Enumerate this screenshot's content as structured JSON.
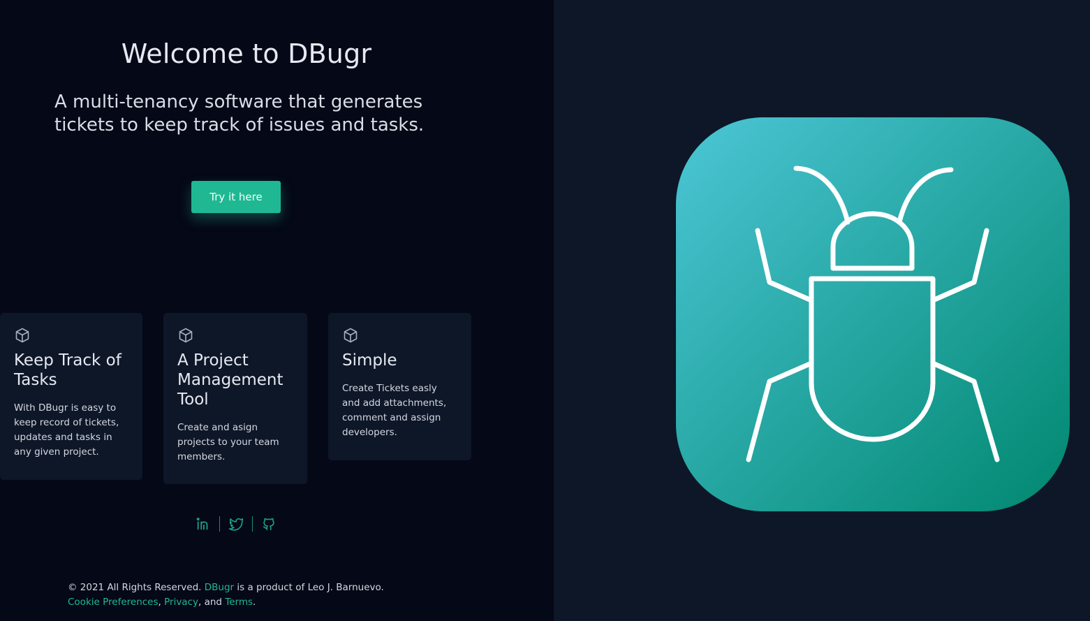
{
  "hero": {
    "title": "Welcome to DBugr",
    "subtitle": "A multi-tenancy software that generates tickets to keep track of issues and tasks.",
    "cta_label": "Try it here"
  },
  "features": [
    {
      "icon": "cube-icon",
      "title": "Keep Track of Tasks",
      "description": "With DBugr is easy to keep record of tickets, updates and tasks in any given project."
    },
    {
      "icon": "cube-icon",
      "title": "A Project Management Tool",
      "description": "Create and asign projects to your team members."
    },
    {
      "icon": "cube-icon",
      "title": "Simple",
      "description": "Create Tickets easly and add attachments, comment and assign developers."
    }
  ],
  "socials": [
    {
      "icon": "linkedin-icon"
    },
    {
      "icon": "twitter-icon"
    },
    {
      "icon": "github-icon"
    }
  ],
  "footer": {
    "copyright": "© 2021 All Rights Reserved.",
    "brand_link": "DBugr",
    "product_of": "is a product of Leo J. Barnuevo.",
    "cookie_link": "Cookie Preferences",
    "sep1": ",",
    "privacy_link": "Privacy",
    "sep2": ", and",
    "terms_link": "Terms",
    "end": "."
  },
  "logo": {
    "icon": "bug-icon",
    "gradient_start": "#4cc6d6",
    "gradient_end": "#00876f"
  },
  "colors": {
    "accent": "#1fb893",
    "left_bg": "#050816",
    "right_bg": "#0e1727",
    "card_bg": "#0e1727"
  }
}
